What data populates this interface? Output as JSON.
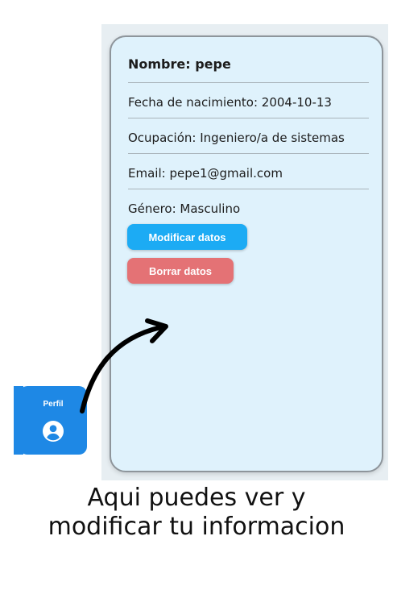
{
  "profile_card": {
    "name": "Nombre: pepe",
    "birthdate": "Fecha de nacimiento: 2004-10-13",
    "occupation": "Ocupación: Ingeniero/a de sistemas",
    "email": "Email: pepe1@gmail.com",
    "gender": "Género: Masculino",
    "modify_label": "Modificar datos",
    "delete_label": "Borrar datos"
  },
  "nav": {
    "profile_label": "Perfil",
    "profile_icon": "account-circle-icon"
  },
  "caption": {
    "line1": "Aqui puedes ver y",
    "line2": "modificar tu informacion"
  },
  "colors": {
    "card_bg": "#dff2fc",
    "modify_button": "#1cabf4",
    "delete_button": "#e47275",
    "nav_tab": "#1e88e5"
  }
}
